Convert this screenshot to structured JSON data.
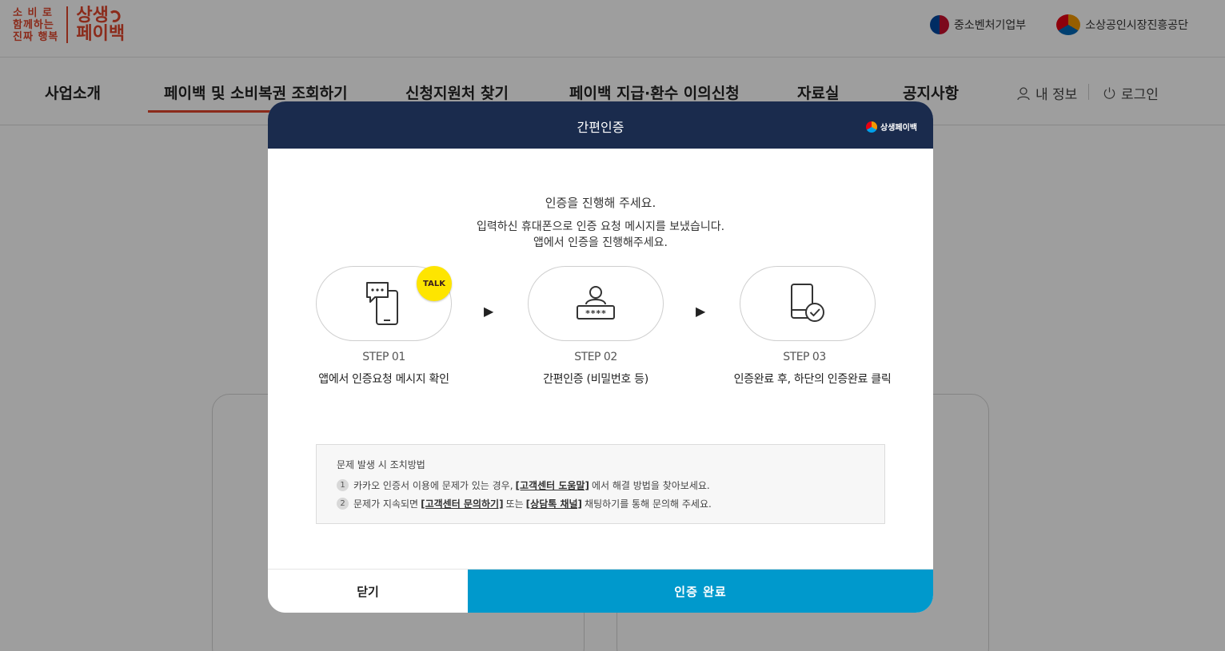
{
  "site": {
    "logo_slogan": [
      "소 비 로",
      "함께하는",
      "진짜 행복"
    ],
    "logo_title_1": "상생",
    "logo_title_2": "페이백",
    "gov_links": [
      {
        "label": "중소벤처기업부",
        "icon": "taegeuk-emblem"
      },
      {
        "label": "소상공인시장진흥공단",
        "icon": "semas-emblem"
      }
    ]
  },
  "nav": {
    "items": [
      "사업소개",
      "페이백 및 소비복권 조회하기",
      "신청지원처 찾기",
      "페이백 지급·환수 이의신청",
      "자료실",
      "공지사항"
    ],
    "active_index": 1,
    "my_info": "내 정보",
    "login": "로그인"
  },
  "modal": {
    "title": "간편인증",
    "header_logo": "상생페이백",
    "intro_title": "인증을 진행해 주세요.",
    "intro_line1": "입력하신 휴대폰으로 인증 요청 메시지를 보냈습니다.",
    "intro_line2": "앱에서 인증을 진행해주세요.",
    "steps": [
      {
        "no": "STEP 01",
        "desc": "앱에서 인증요청 메시지 확인",
        "icon": "phone-chat-icon"
      },
      {
        "no": "STEP 02",
        "desc": "간편인증 (비밀번호 등)",
        "icon": "user-password-icon"
      },
      {
        "no": "STEP 03",
        "desc": "인증완료 후, 하단의 인증완료 클릭",
        "icon": "phone-check-icon"
      }
    ],
    "talk_badge": "TALK",
    "help": {
      "title": "문제 발생 시 조치방법",
      "row1": {
        "num": "1",
        "pre": "카카오 인증서 이용에 문제가 있는 경우,",
        "link": "[고객센터 도움말]",
        "post": "에서 해결 방법을 찾아보세요."
      },
      "row2": {
        "num": "2",
        "pre": "문제가 지속되면",
        "link1": "[고객센터 문의하기]",
        "mid": "또는",
        "link2": "[상담톡 채널]",
        "post": "채팅하기를 통해 문의해 주세요."
      }
    },
    "close_label": "닫기",
    "done_label": "인증 완료"
  },
  "colors": {
    "brand": "#e1462c",
    "modal_header": "#1a2b4d",
    "primary_button": "#0099cc",
    "kakao_yellow": "#fee500"
  }
}
